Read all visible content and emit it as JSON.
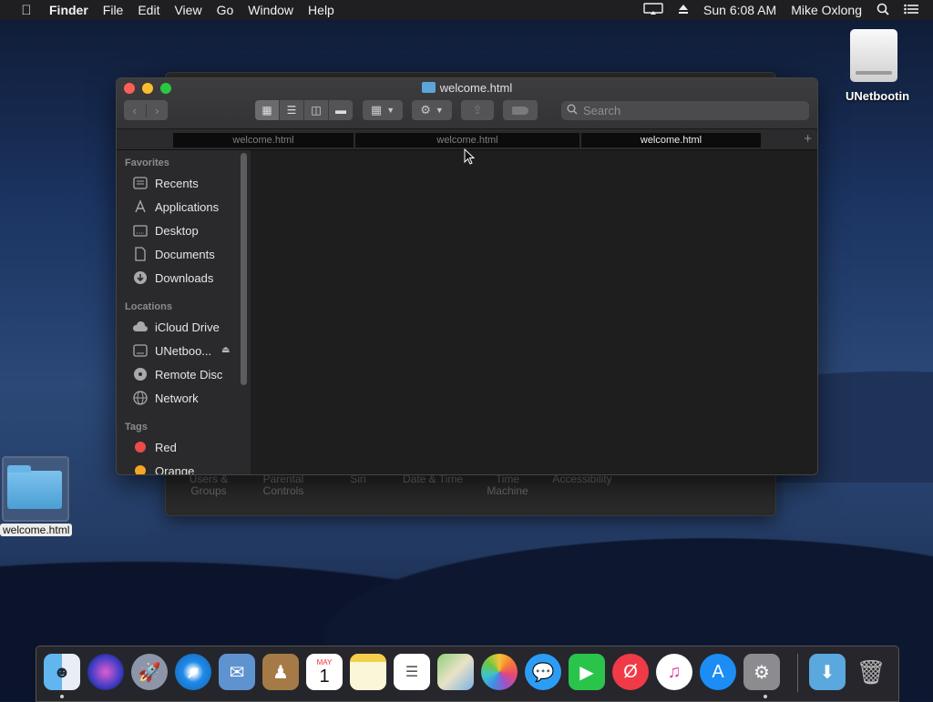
{
  "menubar": {
    "app_name": "Finder",
    "menus": [
      "File",
      "Edit",
      "View",
      "Go",
      "Window",
      "Help"
    ],
    "clock": "Sun 6:08 AM",
    "user": "Mike Oxlong"
  },
  "desktop": {
    "disk_label": "UNetbootin",
    "folder_label": "welcome.html"
  },
  "back_window": {
    "prefs": [
      {
        "label": "Users &\nGroups"
      },
      {
        "label": "Parental\nControls"
      },
      {
        "label": "Siri"
      },
      {
        "label": "Date & Time"
      },
      {
        "label": "Time\nMachine"
      },
      {
        "label": "Accessibility"
      }
    ]
  },
  "finder": {
    "title": "welcome.html",
    "search_placeholder": "Search",
    "tabs": [
      "welcome.html",
      "welcome.html",
      "welcome.html"
    ],
    "active_tab_index": 2,
    "sidebar": {
      "favorites_header": "Favorites",
      "favorites": [
        {
          "label": "Recents",
          "icon": "recents-icon"
        },
        {
          "label": "Applications",
          "icon": "applications-icon"
        },
        {
          "label": "Desktop",
          "icon": "desktop-icon"
        },
        {
          "label": "Documents",
          "icon": "documents-icon"
        },
        {
          "label": "Downloads",
          "icon": "downloads-icon"
        }
      ],
      "locations_header": "Locations",
      "locations": [
        {
          "label": "iCloud Drive",
          "icon": "cloud-icon"
        },
        {
          "label": "UNetboo...",
          "icon": "disk-icon"
        },
        {
          "label": "Remote Disc",
          "icon": "disc-icon"
        },
        {
          "label": "Network",
          "icon": "network-icon"
        }
      ],
      "tags_header": "Tags",
      "tags": [
        {
          "label": "Red",
          "color": "#ec4b48"
        },
        {
          "label": "Orange",
          "color": "#f5a623"
        }
      ]
    }
  },
  "dock": {
    "apps": [
      "Finder",
      "Siri",
      "Launchpad",
      "Safari",
      "Mail",
      "Contacts",
      "Calendar",
      "Notes",
      "Reminders",
      "Maps",
      "Photos",
      "Messages",
      "FaceTime",
      "News",
      "iTunes",
      "App Store",
      "System Preferences"
    ],
    "calendar_month": "MAY",
    "calendar_day": "1"
  }
}
